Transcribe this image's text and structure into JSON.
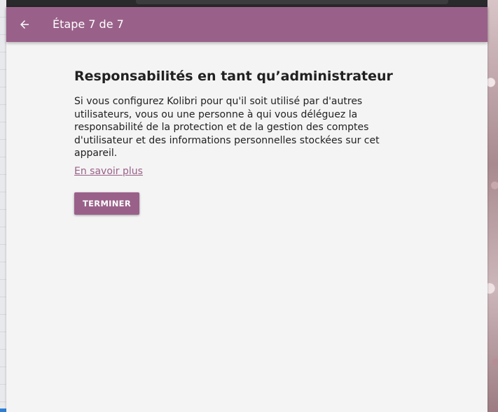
{
  "app_bar": {
    "title": "Étape 7 de 7",
    "back_icon": "arrow-left-icon",
    "color": "#996189"
  },
  "main": {
    "heading": "Responsabilités en tant qu’administrateur",
    "description": "Si vous configurez Kolibri pour qu'il soit utilisé par d'autres utilisateurs, vous ou une personne à qui vous déléguez la responsabilité de la protection et de la gestion des comptes d'utilisateur et des informations personnelles stockées sur cet appareil.",
    "learn_more": "En savoir plus",
    "finish_button": "TERMINER"
  }
}
